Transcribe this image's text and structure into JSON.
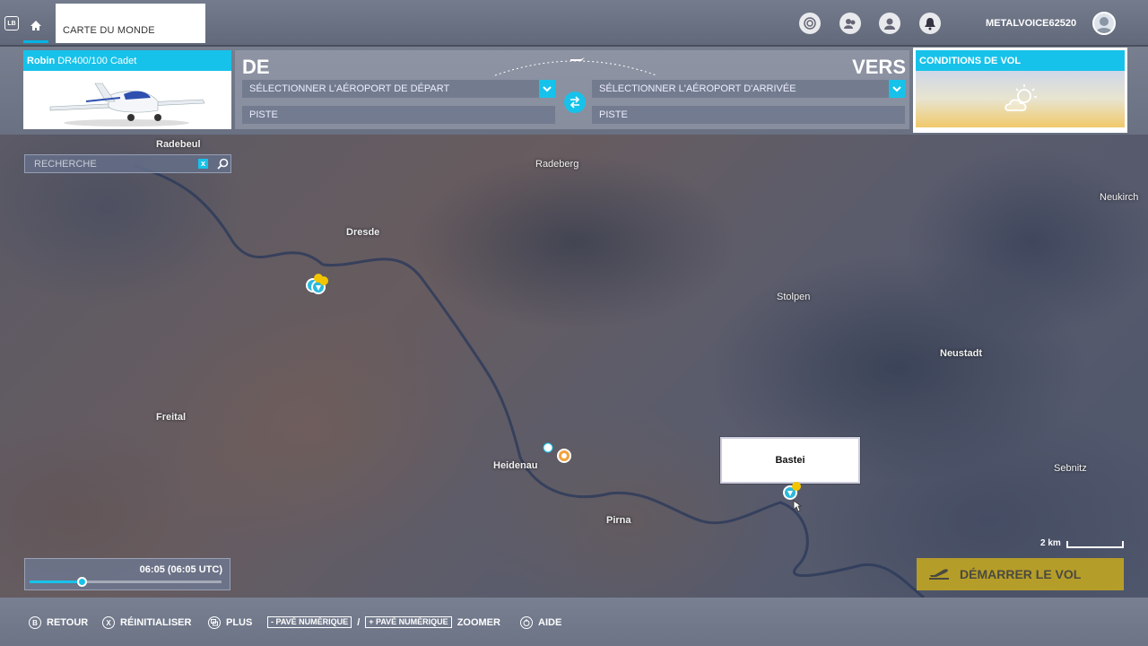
{
  "topbar": {
    "lb_label": "LB",
    "page_title": "CARTE DU MONDE",
    "username": "METALVOICE62520",
    "icons": [
      "activity-icon",
      "friends-icon",
      "profile-icon",
      "notifications-icon"
    ]
  },
  "aircraft": {
    "brand": "Robin",
    "model": "DR400/100 Cadet"
  },
  "route": {
    "from_label": "DE",
    "to_label": "VERS",
    "departure_placeholder": "SÉLECTIONNER L'AÉROPORT DE DÉPART",
    "arrival_placeholder": "SÉLECTIONNER L'AÉROPORT D'ARRIVÉE",
    "departure_runway": "PISTE",
    "arrival_runway": "PISTE"
  },
  "conditions": {
    "title": "CONDITIONS DE VOL",
    "icon": "partly-cloudy-icon"
  },
  "search": {
    "placeholder": "RECHERCHE",
    "clear_label": "x"
  },
  "map": {
    "cities": [
      {
        "name": "Radebeul",
        "bold": true
      },
      {
        "name": "Radeberg",
        "bold": false
      },
      {
        "name": "Neukirch",
        "bold": false
      },
      {
        "name": "Dresde",
        "bold": true
      },
      {
        "name": "Stolpen",
        "bold": false
      },
      {
        "name": "Neustadt",
        "bold": true
      },
      {
        "name": "Freital",
        "bold": true
      },
      {
        "name": "Heidenau",
        "bold": true
      },
      {
        "name": "Pirna",
        "bold": true
      },
      {
        "name": "Sebnitz",
        "bold": false
      }
    ],
    "popup_label": "Bastei",
    "scale_label": "2 km"
  },
  "time": {
    "display": "06:05 (06:05 UTC)",
    "slider_fraction": 0.27
  },
  "actions": {
    "start_flight": "DÉMARRER LE VOL"
  },
  "bottombar": {
    "back_key": "B",
    "back_label": "RETOUR",
    "reset_key": "X",
    "reset_label": "RÉINITIALISER",
    "more_label": "PLUS",
    "zoom_out_key": "- PAVÉ NUMÉRIQUE",
    "zoom_separator": "/",
    "zoom_in_key": "+ PAVÉ NUMÉRIQUE",
    "zoom_label": "ZOOMER",
    "help_label": "AIDE"
  },
  "colors": {
    "accent": "#17c2ea",
    "start_button": "#c8aa1e"
  }
}
